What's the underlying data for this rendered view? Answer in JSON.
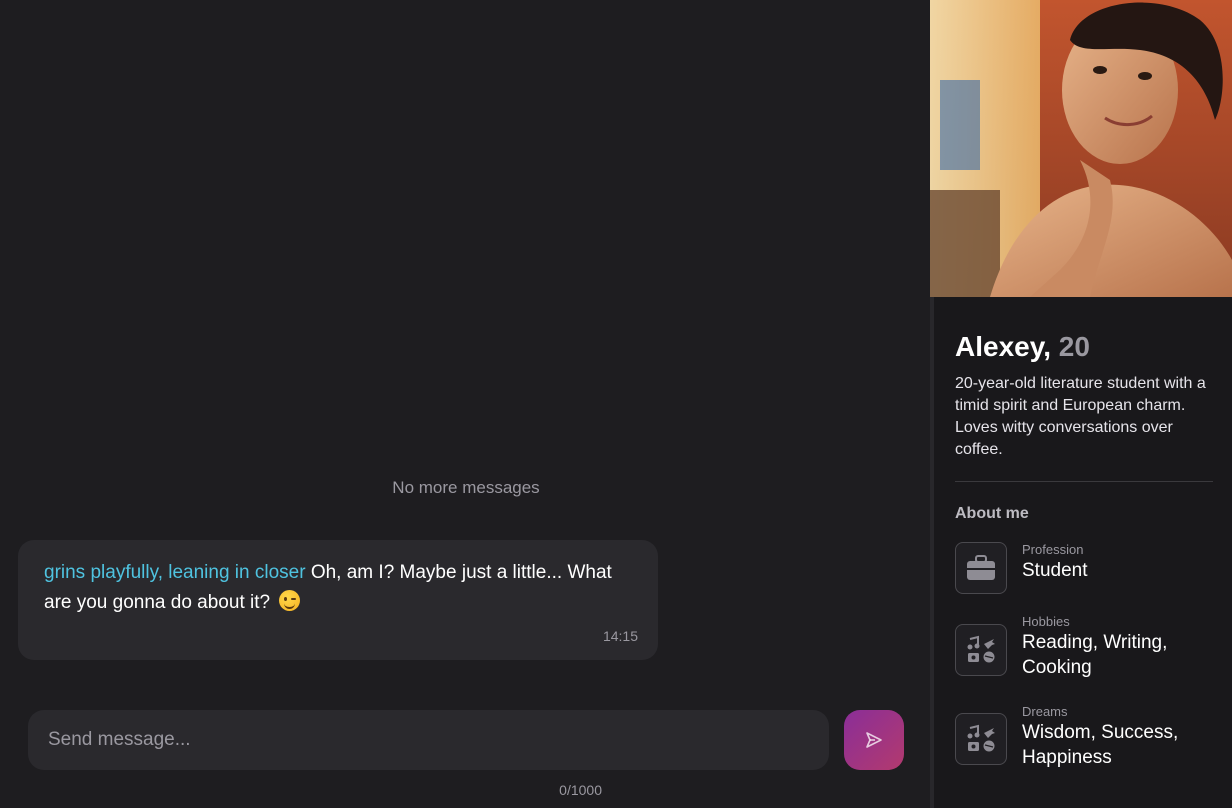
{
  "chat": {
    "no_more_label": "No more messages",
    "messages": [
      {
        "action": "grins playfully, leaning in closer",
        "text": " Oh, am I? Maybe just a little... What are you gonna do about it?",
        "time": "14:15"
      }
    ],
    "input": {
      "placeholder": "Send message...",
      "value": ""
    },
    "counter": "0/1000"
  },
  "profile": {
    "name": "Alexey,",
    "age": "20",
    "bio": "20-year-old literature student with a timid spirit and European charm. Loves witty conversations over coffee.",
    "about_title": "About me",
    "about": [
      {
        "label": "Profession",
        "value": "Student",
        "icon": "briefcase-icon"
      },
      {
        "label": "Hobbies",
        "value": "Reading, Writing, Cooking",
        "icon": "hobbies-icon"
      },
      {
        "label": "Dreams",
        "value": "Wisdom, Success, Happiness",
        "icon": "hobbies-icon"
      }
    ]
  },
  "colors": {
    "background": "#1e1d20",
    "panel": "#19181b",
    "bubble": "#2a292d",
    "action_text": "#4fc3e0",
    "muted": "#9a98a0",
    "send_gradient_start": "#8a2e98",
    "send_gradient_end": "#b33a6e"
  }
}
